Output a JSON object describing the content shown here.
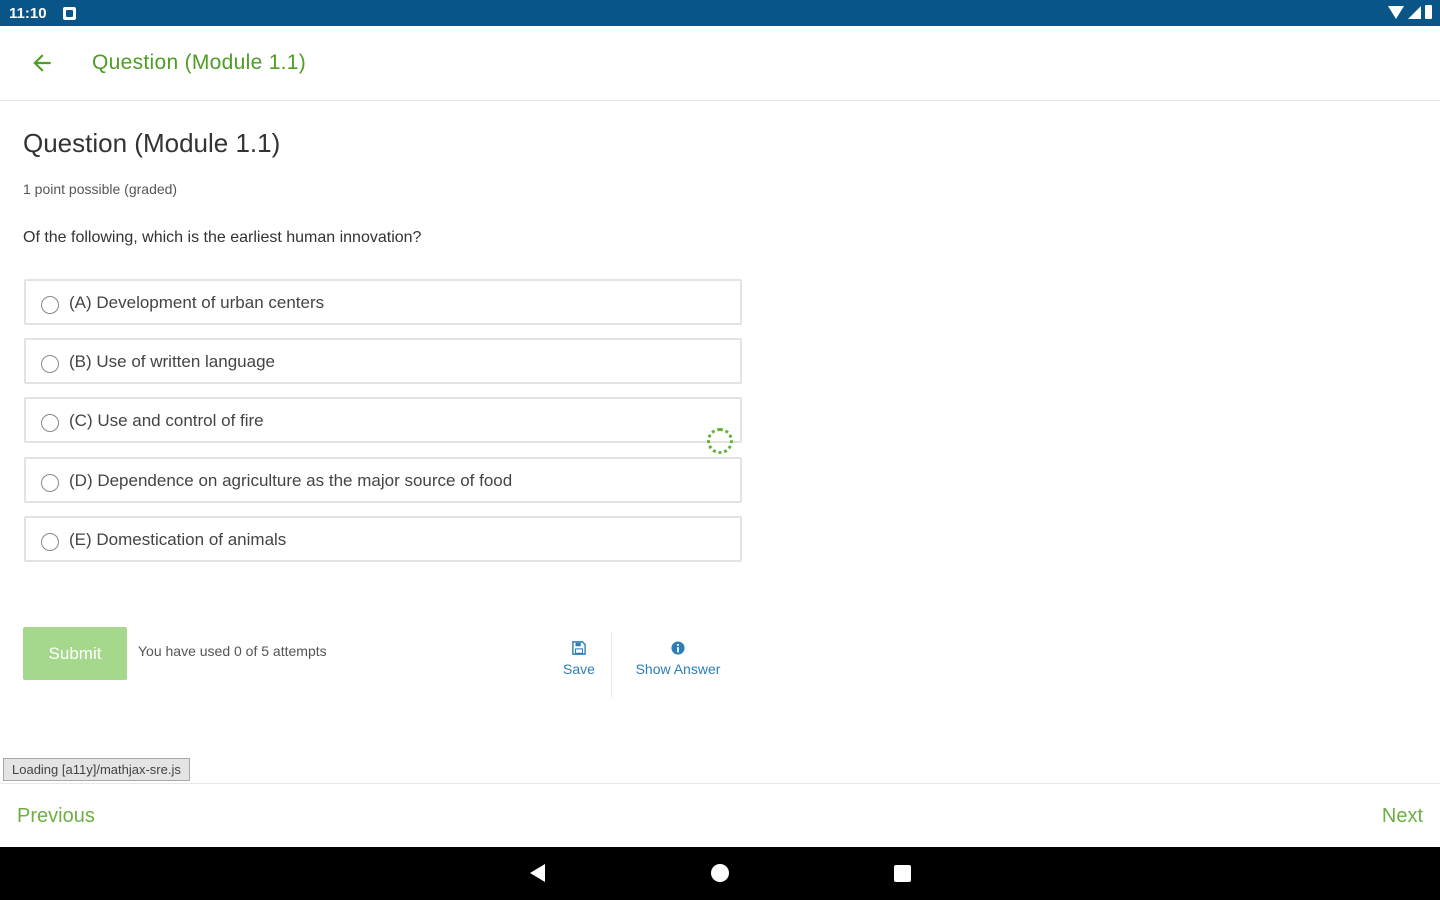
{
  "status_bar": {
    "time": "11:10",
    "icons": [
      "notification-icon",
      "wifi-icon",
      "signal-icon",
      "battery-icon"
    ]
  },
  "app_bar": {
    "back_icon": "arrow-left-icon",
    "title": "Question (Module 1.1)"
  },
  "problem": {
    "title": "Question (Module 1.1)",
    "points": "1 point possible (graded)",
    "question": "Of the following, which is the earliest human innovation?",
    "options": [
      {
        "label": "(A) Development of urban centers",
        "selected": false
      },
      {
        "label": "(B) Use of written language",
        "selected": false
      },
      {
        "label": "(C) Use and control of fire",
        "selected": false
      },
      {
        "label": "(D) Dependence on agriculture as the major source of food",
        "selected": false
      },
      {
        "label": "(E) Domestication of animals",
        "selected": false
      }
    ]
  },
  "actions": {
    "submit_label": "Submit",
    "attempts_text": "You have used 0 of 5 attempts",
    "save_label": "Save",
    "show_answer_label": "Show Answer"
  },
  "loading_text": "Loading [a11y]/mathjax-sre.js",
  "bottom_nav": {
    "previous_label": "Previous",
    "next_label": "Next"
  },
  "colors": {
    "status_bar": "#0a5587",
    "accent_green": "#4e9d24",
    "submit_disabled": "#a5d88c",
    "link_blue": "#2d7db8"
  }
}
